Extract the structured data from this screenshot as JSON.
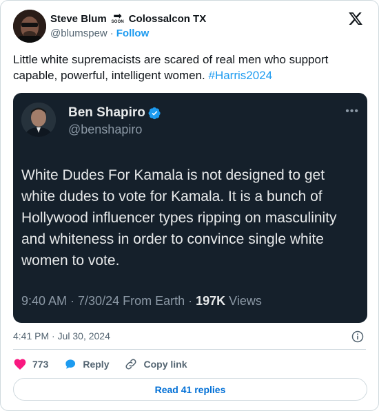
{
  "author": {
    "name": "Steve Blum",
    "name_suffix": "Colossalcon TX",
    "soon_badge": "SOON",
    "handle": "@blumspew",
    "separator": "·",
    "follow_label": "Follow"
  },
  "tweet": {
    "text": "Little white supremacists are scared of real men who support capable, powerful, intelligent women. ",
    "hashtag": "#Harris2024"
  },
  "embedded": {
    "name": "Ben Shapiro",
    "handle": "@benshapiro",
    "more": "•••",
    "body": "White Dudes For Kamala is not designed to get white dudes to vote for Kamala. It is a bunch of Hollywood influencer types ripping on masculinity and whiteness in order to convince single white women to vote.",
    "meta_prefix": "9:40 AM · 7/30/24 From Earth · ",
    "views_count": "197K",
    "views_label": " Views"
  },
  "footer": {
    "timestamp": "4:41 PM · Jul 30, 2024",
    "like_count": "773",
    "reply_label": "Reply",
    "copy_link_label": "Copy link",
    "read_replies_label": "Read 41 replies"
  },
  "colors": {
    "accent": "#1d9bf0",
    "like": "#f91880",
    "embed_bg": "#15202b",
    "muted": "#536471"
  },
  "icons": [
    "x-logo-icon",
    "arrow-right-icon",
    "verified-badge-icon",
    "more-icon",
    "info-icon",
    "heart-icon",
    "reply-bubble-icon",
    "link-icon"
  ]
}
